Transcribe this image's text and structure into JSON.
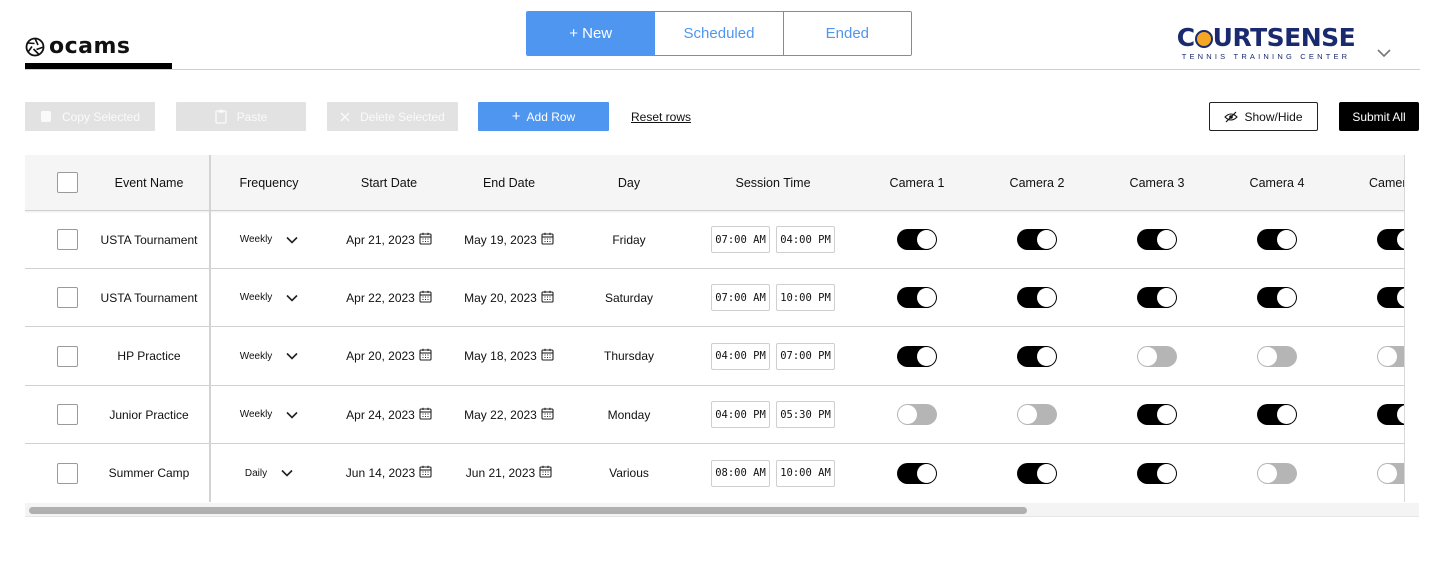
{
  "brand": {
    "name": "ocams"
  },
  "tabs": [
    {
      "label": "+ New",
      "active": true
    },
    {
      "label": "Scheduled",
      "active": false
    },
    {
      "label": "Ended",
      "active": false
    }
  ],
  "client_logo": {
    "main_left": "C",
    "main_right": "URTSENSE",
    "subtitle": "TENNIS TRAINING CENTER",
    "ball_color": "#f5a623",
    "text_color": "#1a2a6e"
  },
  "toolbar": {
    "copy_label": "Copy Selected",
    "paste_label": "Paste",
    "delete_label": "Delete Selected",
    "add_label": "Add Row",
    "reset_label": "Reset rows",
    "showhide_label": "Show/Hide",
    "submit_label": "Submit All"
  },
  "colors": {
    "accent": "#4f96f0",
    "toggle_on": "#000000",
    "toggle_off": "#b5b5b5"
  },
  "table": {
    "headers": {
      "event_name": "Event Name",
      "frequency": "Frequency",
      "start_date": "Start Date",
      "end_date": "End Date",
      "day": "Day",
      "session_time": "Session Time",
      "camera1": "Camera 1",
      "camera2": "Camera 2",
      "camera3": "Camera 3",
      "camera4": "Camera 4",
      "camera5": "Camer"
    },
    "rows": [
      {
        "event": "USTA Tournament",
        "frequency": "Weekly",
        "start": "Apr 21, 2023",
        "end": "May 19, 2023",
        "day": "Friday",
        "time_start": "07:00 AM",
        "time_end": "04:00 PM",
        "cameras": [
          true,
          true,
          true,
          true,
          true
        ]
      },
      {
        "event": "USTA Tournament",
        "frequency": "Weekly",
        "start": "Apr 22, 2023",
        "end": "May 20, 2023",
        "day": "Saturday",
        "time_start": "07:00 AM",
        "time_end": "10:00 PM",
        "cameras": [
          true,
          true,
          true,
          true,
          true
        ]
      },
      {
        "event": "HP Practice",
        "frequency": "Weekly",
        "start": "Apr 20, 2023",
        "end": "May 18, 2023",
        "day": "Thursday",
        "time_start": "04:00 PM",
        "time_end": "07:00 PM",
        "cameras": [
          true,
          true,
          false,
          false,
          false
        ]
      },
      {
        "event": "Junior Practice",
        "frequency": "Weekly",
        "start": "Apr 24, 2023",
        "end": "May 22, 2023",
        "day": "Monday",
        "time_start": "04:00 PM",
        "time_end": "05:30 PM",
        "cameras": [
          false,
          false,
          true,
          true,
          true
        ]
      },
      {
        "event": "Summer Camp",
        "frequency": "Daily",
        "start": "Jun 14, 2023",
        "end": "Jun 21, 2023",
        "day": "Various",
        "time_start": "08:00 AM",
        "time_end": "10:00 AM",
        "cameras": [
          true,
          true,
          true,
          false,
          false
        ]
      }
    ]
  },
  "scrollbar": {
    "position": 0.0,
    "visible_fraction": 0.72
  }
}
